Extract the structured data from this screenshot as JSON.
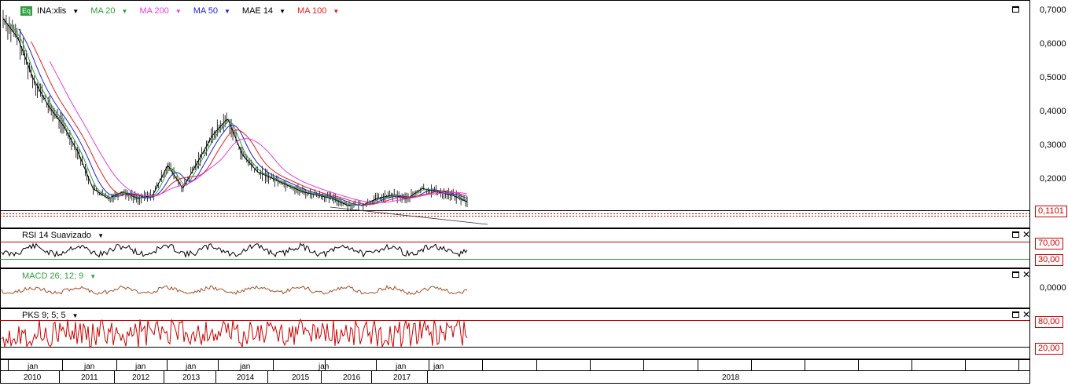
{
  "main": {
    "symbol_badge": "Eq",
    "symbol": "INA:xlis",
    "indicators": [
      {
        "label": "MA 20",
        "color": "#2e9e3e"
      },
      {
        "label": "MA 200",
        "color": "#e040e0"
      },
      {
        "label": "MA 50",
        "color": "#2020d0"
      },
      {
        "label": "MAE 14",
        "color": "#000000"
      },
      {
        "label": "MA 100",
        "color": "#e02020"
      }
    ],
    "y_ticks": [
      "0,7000",
      "0,6000",
      "0,5000",
      "0,4000",
      "0,3000",
      "0,2000"
    ],
    "last_price": "0,1101"
  },
  "rsi": {
    "title": "RSI 14 Suavizado",
    "upper": "70,00",
    "lower": "30,00"
  },
  "macd": {
    "title": "MACD 26; 12; 9",
    "zero": "0,0000"
  },
  "pks": {
    "title": "PKS 9; 5; 5",
    "upper": "80,00",
    "lower": "20,00"
  },
  "xaxis": {
    "month_labels": [
      "jan",
      "jan",
      "jan",
      "jan",
      "jan",
      "jan",
      "jan",
      "jan"
    ],
    "year_labels": [
      "2010",
      "2011",
      "2012",
      "2013",
      "2014",
      "2015",
      "2016",
      "2017",
      "2018"
    ]
  },
  "chart_data": {
    "type": "line",
    "price_series": {
      "name": "INA:xlis",
      "x": [
        "2010-01",
        "2010-04",
        "2010-07",
        "2010-10",
        "2011-01",
        "2011-04",
        "2011-07",
        "2011-10",
        "2012-01",
        "2012-04",
        "2012-07",
        "2012-10",
        "2013-01",
        "2013-04",
        "2013-07",
        "2013-10",
        "2014-01",
        "2014-04",
        "2014-07",
        "2014-10",
        "2015-01",
        "2015-04",
        "2015-07",
        "2015-10",
        "2016-01",
        "2016-04",
        "2016-07",
        "2016-10",
        "2017-01",
        "2017-04",
        "2017-07",
        "2017-10"
      ],
      "y": [
        0.68,
        0.62,
        0.5,
        0.42,
        0.36,
        0.28,
        0.17,
        0.14,
        0.16,
        0.14,
        0.15,
        0.24,
        0.17,
        0.25,
        0.33,
        0.38,
        0.27,
        0.22,
        0.2,
        0.18,
        0.16,
        0.15,
        0.14,
        0.12,
        0.12,
        0.14,
        0.15,
        0.14,
        0.17,
        0.16,
        0.15,
        0.13
      ]
    },
    "y_range": [
      0.1,
      0.7
    ],
    "rsi_levels": [
      70,
      30
    ],
    "pks_levels": [
      80,
      20
    ]
  }
}
